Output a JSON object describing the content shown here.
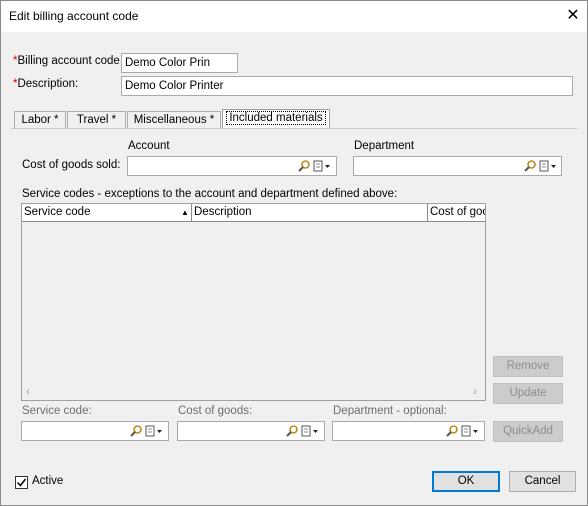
{
  "window": {
    "title": "Edit billing account code",
    "close_glyph": "✕"
  },
  "header": {
    "billing_code": {
      "asterisk": "*",
      "label": "Billing account code",
      "value": "Demo Color Prin"
    },
    "description": {
      "asterisk": "*",
      "label": "Description",
      "colon": ":",
      "value": "Demo Color Printer"
    }
  },
  "tabs": [
    {
      "label": "Labor *"
    },
    {
      "label": "Travel *"
    },
    {
      "label": "Miscellaneous *"
    },
    {
      "label": "Included materials",
      "active": true
    }
  ],
  "panel": {
    "account_header": "Account",
    "department_header": "Department",
    "cogs_label": "Cost of goods sold:",
    "account_value": "",
    "department_value": "",
    "exceptions_label": "Service codes - exceptions to the account and department defined above:",
    "grid": {
      "columns": [
        "Service code",
        "Description",
        "Cost of goo"
      ],
      "sort_indicator": "▲",
      "rows": []
    },
    "buttons": {
      "remove": "Remove",
      "update": "Update",
      "quickadd": "QuickAdd"
    },
    "bottom_fields": {
      "service_code_label": "Service code:",
      "cost_of_goods_label": "Cost of goods:",
      "department_label": "Department - optional:"
    }
  },
  "footer": {
    "active_label": "Active",
    "active_checked": true,
    "ok": "OK",
    "cancel": "Cancel"
  },
  "icons": [
    "search-icon",
    "browse-dropdown-icon",
    "close-icon",
    "checkmark-icon",
    "sort-asc-icon",
    "scroll-left-icon",
    "scroll-right-icon"
  ]
}
